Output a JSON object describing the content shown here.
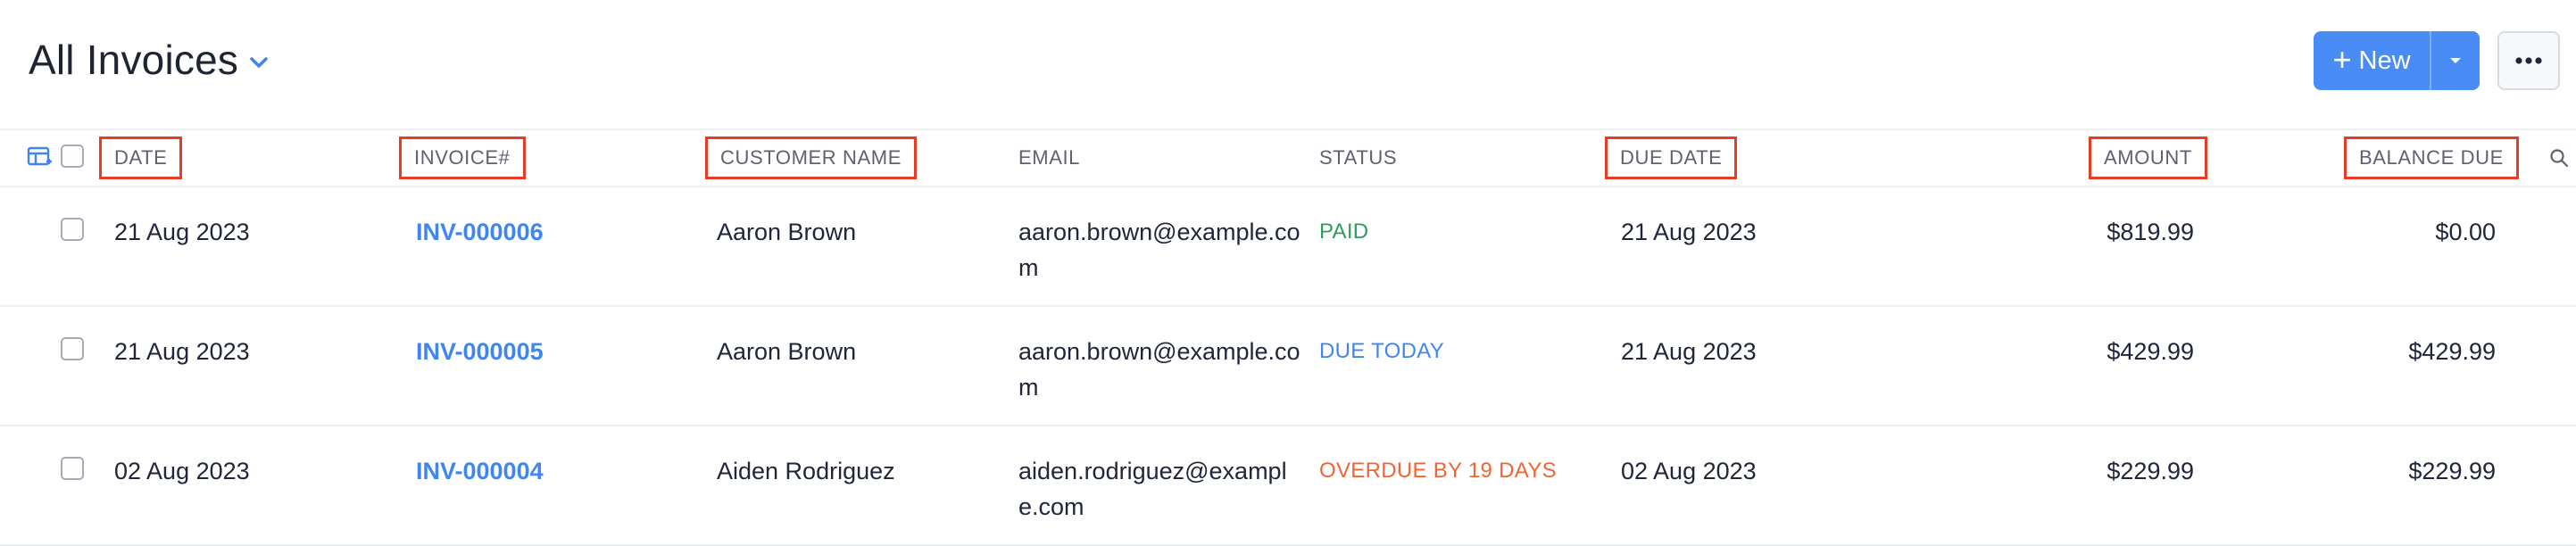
{
  "header": {
    "title": "All Invoices",
    "new_label": "New"
  },
  "icons": {
    "title_caret": "chevron-down-icon",
    "new_plus": "plus-icon",
    "new_split": "caret-down-icon",
    "more": "ellipsis-icon",
    "customize_columns": "table-settings-icon",
    "search": "search-icon"
  },
  "colors": {
    "accent": "#4a8cf5",
    "link": "#3f86f0",
    "paid": "#2aa05a",
    "due_today": "#3f86f0",
    "overdue": "#f26432",
    "highlight_box": "#e63d24"
  },
  "table": {
    "columns": [
      "DATE",
      "INVOICE#",
      "CUSTOMER NAME",
      "EMAIL",
      "STATUS",
      "DUE DATE",
      "AMOUNT",
      "BALANCE DUE"
    ],
    "rows": [
      {
        "date": "21 Aug 2023",
        "invoice": "INV-000006",
        "customer": "Aaron Brown",
        "email": "aaron.brown@example.com",
        "status": "PAID",
        "status_kind": "paid",
        "due_date": "21 Aug 2023",
        "amount": "$819.99",
        "balance": "$0.00"
      },
      {
        "date": "21 Aug 2023",
        "invoice": "INV-000005",
        "customer": "Aaron Brown",
        "email": "aaron.brown@example.com",
        "status": "DUE TODAY",
        "status_kind": "due_today",
        "due_date": "21 Aug 2023",
        "amount": "$429.99",
        "balance": "$429.99"
      },
      {
        "date": "02 Aug 2023",
        "invoice": "INV-000004",
        "customer": "Aiden Rodriguez",
        "email": "aiden.rodriguez@example.com",
        "status": "OVERDUE BY 19 DAYS",
        "status_kind": "overdue",
        "due_date": "02 Aug 2023",
        "amount": "$229.99",
        "balance": "$229.99"
      }
    ]
  }
}
